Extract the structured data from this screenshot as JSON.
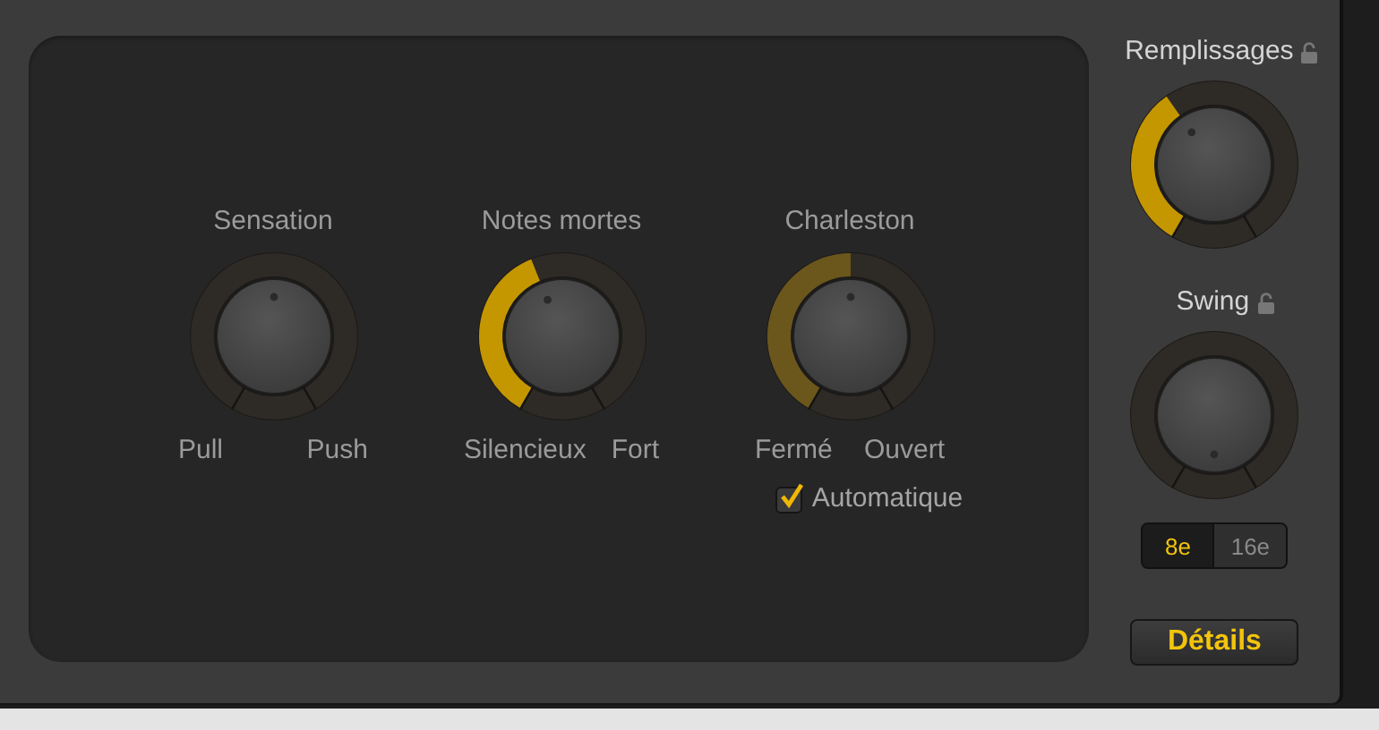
{
  "panel": {
    "knobs": [
      {
        "title": "Sensation",
        "kind": "bipolar",
        "labels": [
          "Pull",
          "Push"
        ]
      },
      {
        "title": "Notes mortes",
        "kind": "unipolar",
        "labels": [
          "Silencieux",
          "Fort"
        ]
      },
      {
        "title": "Charleston",
        "kind": "unipolar",
        "dimmed": true,
        "labels": [
          "Fermé",
          "Ouvert"
        ],
        "checkbox": {
          "label": "Automatique",
          "checked": true
        }
      }
    ]
  },
  "side": {
    "knobs": [
      {
        "title": "Remplissages",
        "locked": false,
        "kind": "unipolar"
      },
      {
        "title": "Swing",
        "locked": false,
        "kind": "none"
      }
    ],
    "segments": [
      {
        "label": "8e",
        "selected": true
      },
      {
        "label": "16e",
        "selected": false
      }
    ],
    "button": "Détails"
  }
}
